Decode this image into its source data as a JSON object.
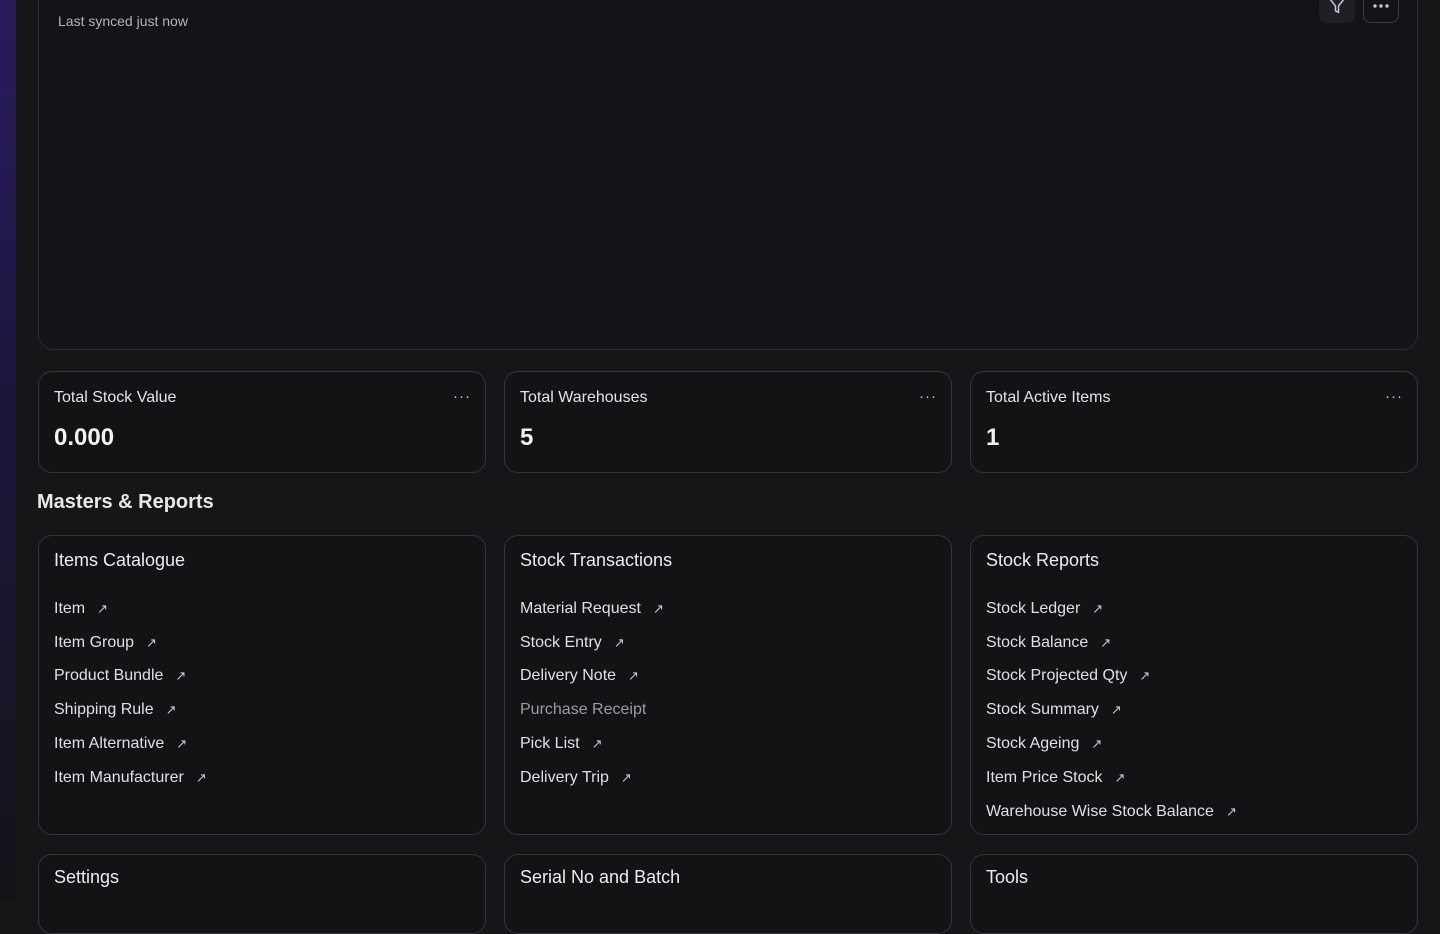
{
  "chart_card": {
    "synced_text": "Last synced just now"
  },
  "stats": [
    {
      "label": "Total Stock Value",
      "value": "0.000"
    },
    {
      "label": "Total Warehouses",
      "value": "5"
    },
    {
      "label": "Total Active Items",
      "value": "1"
    }
  ],
  "menu_dots": "···",
  "section_title": "Masters & Reports",
  "link_cards": [
    {
      "title": "Items Catalogue",
      "items": [
        "Item",
        "Item Group",
        "Product Bundle",
        "Shipping Rule",
        "Item Alternative",
        "Item Manufacturer"
      ]
    },
    {
      "title": "Stock Transactions",
      "items": [
        "Material Request",
        "Stock Entry",
        "Delivery Note",
        "Purchase Receipt",
        "Pick List",
        "Delivery Trip"
      ]
    },
    {
      "title": "Stock Reports",
      "items": [
        "Stock Ledger",
        "Stock Balance",
        "Stock Projected Qty",
        "Stock Summary",
        "Stock Ageing",
        "Item Price Stock",
        "Warehouse Wise Stock Balance"
      ]
    }
  ],
  "bottom_cards": [
    {
      "title": "Settings"
    },
    {
      "title": "Serial No and Batch"
    },
    {
      "title": "Tools"
    }
  ],
  "arrow_glyph": "↗"
}
